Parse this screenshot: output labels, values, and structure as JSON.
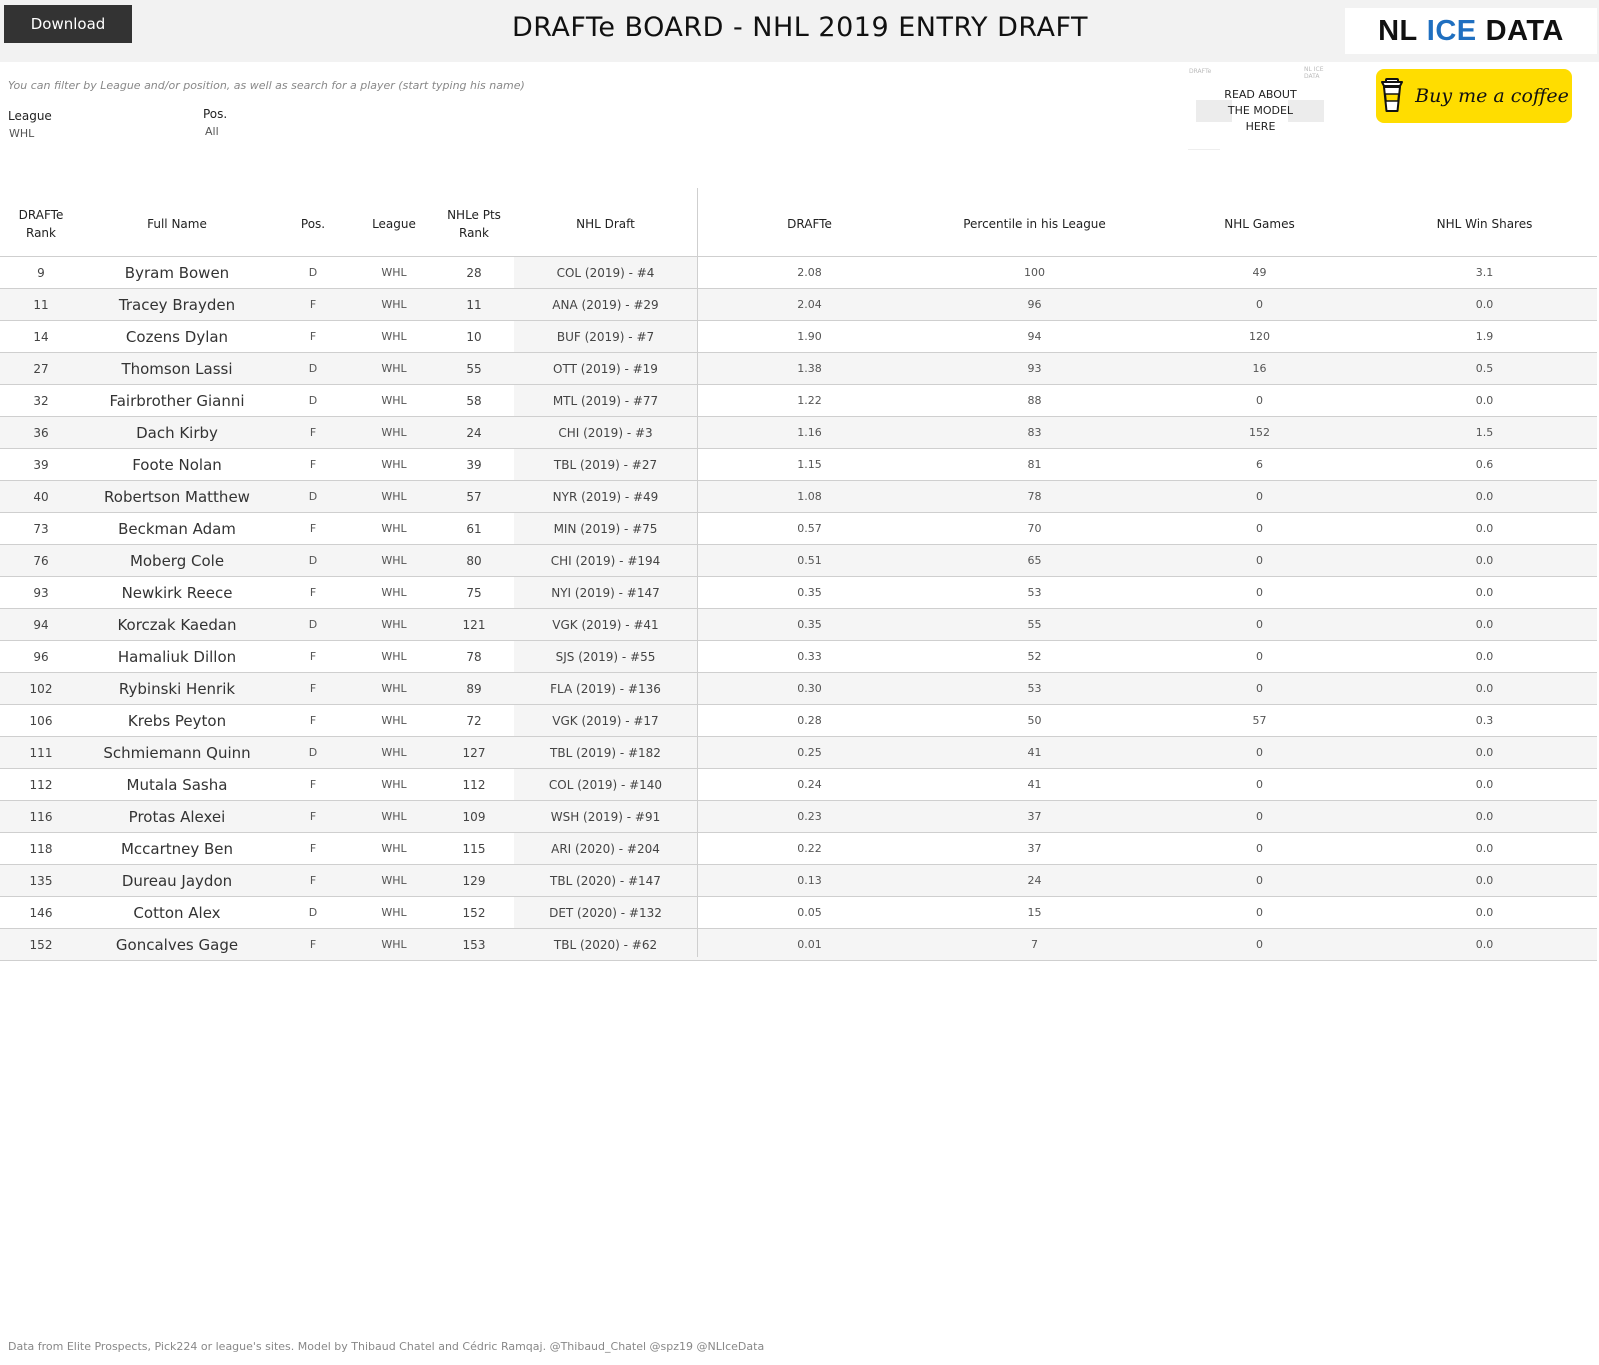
{
  "header": {
    "download_label": "Download",
    "title": "DRAFTe BOARD - NHL 2019 ENTRY DRAFT",
    "logo": {
      "part1": "NL",
      "part2": "ICE",
      "part3": "DATA"
    }
  },
  "filters": {
    "hint": "You can filter by League and/or position, as well as search for a player (start typing his name)",
    "league": {
      "label": "League",
      "value": "WHL"
    },
    "position": {
      "label": "Pos.",
      "value": "All"
    }
  },
  "read_about": {
    "line1": "READ ABOUT",
    "line2": "THE MODEL",
    "line3": "HERE",
    "tiny_left": "DRAFTe",
    "tiny_right": "NL ICE DATA"
  },
  "coffee": {
    "label": "Buy me a coffee",
    "color": "#ffdd00"
  },
  "table": {
    "columns": {
      "rank_l1": "DRAFTe",
      "rank_l2": "Rank",
      "name": "Full Name",
      "pos": "Pos.",
      "league": "League",
      "pts_l1": "NHLe Pts",
      "pts_l2": "Rank",
      "draft": "NHL Draft",
      "drafte": "DRAFTe",
      "percentile": "Percentile in his League",
      "games": "NHL Games",
      "ws": "NHL Win Shares"
    },
    "rows": [
      {
        "rank": "9",
        "name": "Byram Bowen",
        "pos": "D",
        "league": "WHL",
        "pts_rank": "28",
        "draft": "COL (2019) - #4",
        "drafte": "2.08",
        "percentile": "100",
        "games": "49",
        "ws": "3.1"
      },
      {
        "rank": "11",
        "name": "Tracey Brayden",
        "pos": "F",
        "league": "WHL",
        "pts_rank": "11",
        "draft": "ANA (2019) - #29",
        "drafte": "2.04",
        "percentile": "96",
        "games": "0",
        "ws": "0.0"
      },
      {
        "rank": "14",
        "name": "Cozens Dylan",
        "pos": "F",
        "league": "WHL",
        "pts_rank": "10",
        "draft": "BUF (2019) - #7",
        "drafte": "1.90",
        "percentile": "94",
        "games": "120",
        "ws": "1.9"
      },
      {
        "rank": "27",
        "name": "Thomson Lassi",
        "pos": "D",
        "league": "WHL",
        "pts_rank": "55",
        "draft": "OTT (2019) - #19",
        "drafte": "1.38",
        "percentile": "93",
        "games": "16",
        "ws": "0.5"
      },
      {
        "rank": "32",
        "name": "Fairbrother Gianni",
        "pos": "D",
        "league": "WHL",
        "pts_rank": "58",
        "draft": "MTL (2019) - #77",
        "drafte": "1.22",
        "percentile": "88",
        "games": "0",
        "ws": "0.0"
      },
      {
        "rank": "36",
        "name": "Dach Kirby",
        "pos": "F",
        "league": "WHL",
        "pts_rank": "24",
        "draft": "CHI (2019) - #3",
        "drafte": "1.16",
        "percentile": "83",
        "games": "152",
        "ws": "1.5"
      },
      {
        "rank": "39",
        "name": "Foote Nolan",
        "pos": "F",
        "league": "WHL",
        "pts_rank": "39",
        "draft": "TBL (2019) - #27",
        "drafte": "1.15",
        "percentile": "81",
        "games": "6",
        "ws": "0.6"
      },
      {
        "rank": "40",
        "name": "Robertson Matthew",
        "pos": "D",
        "league": "WHL",
        "pts_rank": "57",
        "draft": "NYR (2019) - #49",
        "drafte": "1.08",
        "percentile": "78",
        "games": "0",
        "ws": "0.0"
      },
      {
        "rank": "73",
        "name": "Beckman Adam",
        "pos": "F",
        "league": "WHL",
        "pts_rank": "61",
        "draft": "MIN (2019) - #75",
        "drafte": "0.57",
        "percentile": "70",
        "games": "0",
        "ws": "0.0"
      },
      {
        "rank": "76",
        "name": "Moberg Cole",
        "pos": "D",
        "league": "WHL",
        "pts_rank": "80",
        "draft": "CHI (2019) - #194",
        "drafte": "0.51",
        "percentile": "65",
        "games": "0",
        "ws": "0.0"
      },
      {
        "rank": "93",
        "name": "Newkirk Reece",
        "pos": "F",
        "league": "WHL",
        "pts_rank": "75",
        "draft": "NYI (2019) - #147",
        "drafte": "0.35",
        "percentile": "53",
        "games": "0",
        "ws": "0.0"
      },
      {
        "rank": "94",
        "name": "Korczak Kaedan",
        "pos": "D",
        "league": "WHL",
        "pts_rank": "121",
        "draft": "VGK (2019) - #41",
        "drafte": "0.35",
        "percentile": "55",
        "games": "0",
        "ws": "0.0"
      },
      {
        "rank": "96",
        "name": "Hamaliuk Dillon",
        "pos": "F",
        "league": "WHL",
        "pts_rank": "78",
        "draft": "SJS (2019) - #55",
        "drafte": "0.33",
        "percentile": "52",
        "games": "0",
        "ws": "0.0"
      },
      {
        "rank": "102",
        "name": "Rybinski Henrik",
        "pos": "F",
        "league": "WHL",
        "pts_rank": "89",
        "draft": "FLA (2019) - #136",
        "drafte": "0.30",
        "percentile": "53",
        "games": "0",
        "ws": "0.0"
      },
      {
        "rank": "106",
        "name": "Krebs Peyton",
        "pos": "F",
        "league": "WHL",
        "pts_rank": "72",
        "draft": "VGK (2019) - #17",
        "drafte": "0.28",
        "percentile": "50",
        "games": "57",
        "ws": "0.3"
      },
      {
        "rank": "111",
        "name": "Schmiemann Quinn",
        "pos": "D",
        "league": "WHL",
        "pts_rank": "127",
        "draft": "TBL (2019) - #182",
        "drafte": "0.25",
        "percentile": "41",
        "games": "0",
        "ws": "0.0"
      },
      {
        "rank": "112",
        "name": "Mutala Sasha",
        "pos": "F",
        "league": "WHL",
        "pts_rank": "112",
        "draft": "COL (2019) - #140",
        "drafte": "0.24",
        "percentile": "41",
        "games": "0",
        "ws": "0.0"
      },
      {
        "rank": "116",
        "name": "Protas Alexei",
        "pos": "F",
        "league": "WHL",
        "pts_rank": "109",
        "draft": "WSH (2019) - #91",
        "drafte": "0.23",
        "percentile": "37",
        "games": "0",
        "ws": "0.0"
      },
      {
        "rank": "118",
        "name": "Mccartney Ben",
        "pos": "F",
        "league": "WHL",
        "pts_rank": "115",
        "draft": "ARI (2020) - #204",
        "drafte": "0.22",
        "percentile": "37",
        "games": "0",
        "ws": "0.0"
      },
      {
        "rank": "135",
        "name": "Dureau Jaydon",
        "pos": "F",
        "league": "WHL",
        "pts_rank": "129",
        "draft": "TBL (2020) - #147",
        "drafte": "0.13",
        "percentile": "24",
        "games": "0",
        "ws": "0.0"
      },
      {
        "rank": "146",
        "name": "Cotton Alex",
        "pos": "D",
        "league": "WHL",
        "pts_rank": "152",
        "draft": "DET (2020) - #132",
        "drafte": "0.05",
        "percentile": "15",
        "games": "0",
        "ws": "0.0"
      },
      {
        "rank": "152",
        "name": "Goncalves Gage",
        "pos": "F",
        "league": "WHL",
        "pts_rank": "153",
        "draft": "TBL (2020) - #62",
        "drafte": "0.01",
        "percentile": "7",
        "games": "0",
        "ws": "0.0"
      }
    ]
  },
  "footer": "Data from Elite Prospects, Pick224 or league's sites. Model by Thibaud Chatel and Cédric Ramqaj. @Thibaud_Chatel @spz19 @NLIceData"
}
